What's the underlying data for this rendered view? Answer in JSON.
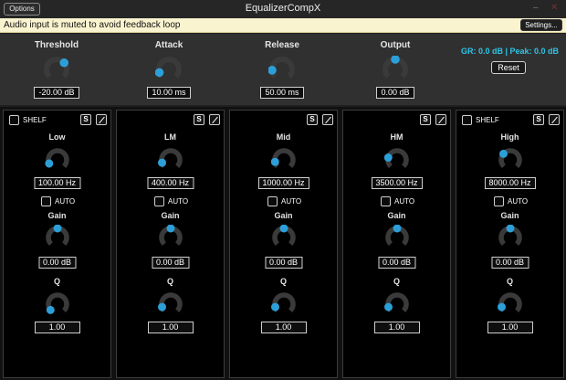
{
  "window": {
    "title": "EqualizerCompX",
    "options_label": "Options",
    "minimize_glyph": "–",
    "close_glyph": "✕"
  },
  "banner": {
    "text": "Audio input is muted to avoid feedback loop",
    "settings_label": "Settings..."
  },
  "compressor": {
    "params": [
      {
        "label": "Threshold",
        "value": "-20.00 dB",
        "level": 0.68
      },
      {
        "label": "Attack",
        "value": "10.00 ms",
        "level": 0.1
      },
      {
        "label": "Release",
        "value": "50.00 ms",
        "level": 0.15
      },
      {
        "label": "Output",
        "value": "0.00 dB",
        "level": 0.5
      }
    ],
    "gr_readout": "GR: 0.0 dB | Peak: 0.0 dB",
    "reset_label": "Reset"
  },
  "bands": [
    {
      "name": "Low",
      "shelf": true,
      "freq": "100.00 Hz",
      "freq_level": 0.08,
      "gain": "0.00 dB",
      "gain_level": 0.5,
      "q": "1.00",
      "q_level": 0.02
    },
    {
      "name": "LM",
      "shelf": false,
      "freq": "400.00 Hz",
      "freq_level": 0.1,
      "gain": "0.00 dB",
      "gain_level": 0.5,
      "q": "1.00",
      "q_level": 0.1
    },
    {
      "name": "Mid",
      "shelf": false,
      "freq": "1000.00 Hz",
      "freq_level": 0.12,
      "gain": "0.00 dB",
      "gain_level": 0.5,
      "q": "1.00",
      "q_level": 0.1
    },
    {
      "name": "HM",
      "shelf": false,
      "freq": "3500.00 Hz",
      "freq_level": 0.22,
      "gain": "0.00 dB",
      "gain_level": 0.5,
      "q": "1.00",
      "q_level": 0.1
    },
    {
      "name": "High",
      "shelf": true,
      "freq": "8000.00 Hz",
      "freq_level": 0.32,
      "gain": "0.00 dB",
      "gain_level": 0.5,
      "q": "1.00",
      "q_level": 0.1
    }
  ],
  "labels": {
    "shelf": "SHELF",
    "auto": "AUTO",
    "gain": "Gain",
    "q": "Q",
    "solo": "S"
  },
  "colors": {
    "accent": "#2d9fd8",
    "knob_track": "#3a3a3a",
    "gr_text": "#2ec4e6"
  }
}
